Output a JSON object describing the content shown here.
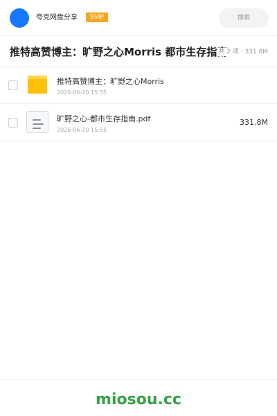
{
  "header": {
    "app_name": "夸克网盘分享",
    "badge": "SVIP",
    "search_label": "搜索",
    "avatar_color": "#1677ff",
    "badge_color": "#f5a623"
  },
  "title_bar": {
    "title": "推特高赞博主：旷野之心Morris 都市生存指南",
    "summary": "共 2 项 · 331.8M"
  },
  "files": [
    {
      "icon": "folder-icon",
      "name": "推特高赞博主：旷野之心Morris",
      "date": "2026-06-20 15:55",
      "size": ""
    },
    {
      "icon": "document-icon",
      "name": "旷野之心-都市生存指南.pdf",
      "date": "2026-06-20 15:55",
      "size": "331.8M"
    }
  ],
  "footer": {
    "brand": "miosou.cc",
    "brand_color": "#3aa04a"
  }
}
